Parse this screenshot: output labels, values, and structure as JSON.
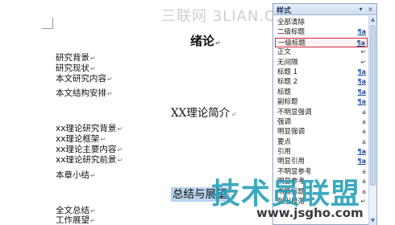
{
  "watermark": {
    "top": "三联网 3LIAN.COM",
    "bottom": "技术员联盟",
    "url": "www.jsgho.com"
  },
  "document": {
    "para_mark": "↵",
    "heading_main": "绪论",
    "block1": [
      "研究背景",
      "研究现状",
      "本文研究内容",
      "本文结构安排"
    ],
    "heading_sub": "XX理论简介",
    "block2": [
      "xx理论研究背景",
      "xx理论框架",
      "xx理论主要内容",
      "xx理论研究前景",
      "本章小结"
    ],
    "heading_sel": "总结与展望",
    "block3": [
      "全文总结",
      "工作展望"
    ]
  },
  "styles_pane": {
    "title": "样式",
    "pin_icon": "▾",
    "close_icon": "×",
    "items": [
      {
        "label": "全部清除",
        "glyph": ""
      },
      {
        "label": "二级标题",
        "glyph": "¶a"
      },
      {
        "label": "一级标题",
        "glyph": "¶a"
      },
      {
        "label": "正文",
        "glyph": "↵"
      },
      {
        "label": "无间隔",
        "glyph": "↵"
      },
      {
        "label": "标题 1",
        "glyph": "¶a"
      },
      {
        "label": "标题 2",
        "glyph": "¶a"
      },
      {
        "label": "标题",
        "glyph": "¶a"
      },
      {
        "label": "副标题",
        "glyph": "¶a"
      },
      {
        "label": "不明显强调",
        "glyph": "a"
      },
      {
        "label": "强调",
        "glyph": "a"
      },
      {
        "label": "明显强调",
        "glyph": "a"
      },
      {
        "label": "要点",
        "glyph": "a"
      },
      {
        "label": "引用",
        "glyph": "¶a"
      },
      {
        "label": "明显引用",
        "glyph": "¶a"
      },
      {
        "label": "不明显参考",
        "glyph": "a"
      },
      {
        "label": "明显参考",
        "glyph": "a"
      },
      {
        "label": "书籍标题",
        "glyph": "a"
      },
      {
        "label": "列出段落",
        "glyph": "↵"
      }
    ],
    "selected_label": "一级标题"
  },
  "colors": {
    "selection_border": "#d0253a",
    "heading_highlight": "#b9d2ee",
    "pane_border": "#8fa6c4"
  }
}
